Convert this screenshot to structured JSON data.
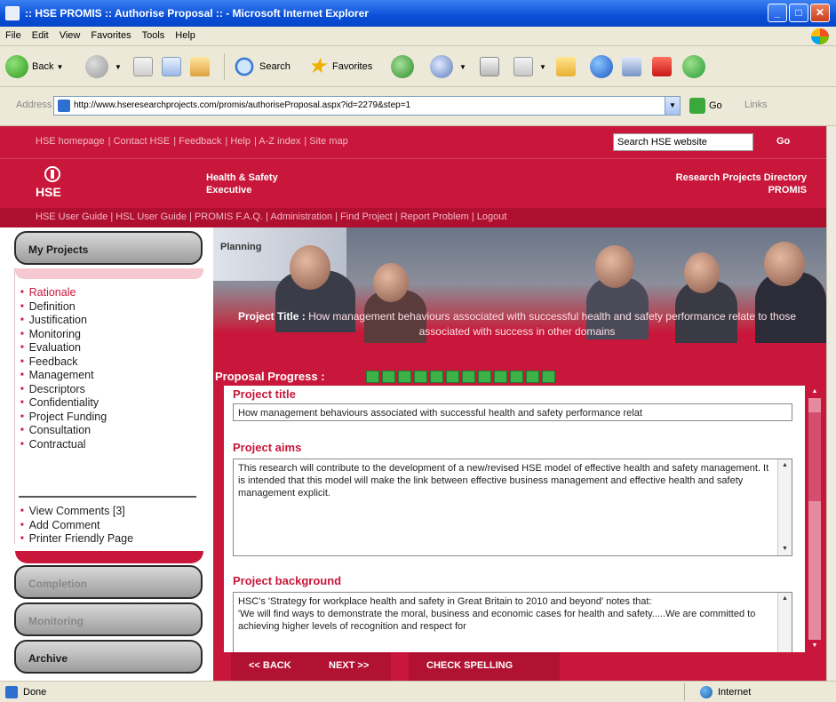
{
  "window": {
    "title": ":: HSE PROMIS :: Authorise Proposal :: - Microsoft Internet Explorer",
    "min": "_",
    "max": "□",
    "close": "✕"
  },
  "menu": [
    "File",
    "Edit",
    "View",
    "Favorites",
    "Tools",
    "Help"
  ],
  "toolbar": {
    "back": "Back",
    "search": "Search",
    "favorites": "Favorites"
  },
  "address": {
    "label": "Address",
    "url": "http://www.hseresearchprojects.com/promis/authoriseProposal.aspx?id=2279&step=1",
    "go": "Go",
    "links": "Links"
  },
  "site": {
    "top_links": [
      "HSE homepage",
      "Contact HSE",
      "Feedback",
      "Help",
      "A-Z index",
      "Site map"
    ],
    "search_value": "Search HSE website",
    "search_go": "Go",
    "logo_text": "HSE",
    "org_line1": "Health & Safety",
    "org_line2": "Executive",
    "rpd_line1": "Research Projects Directory",
    "rpd_line2": "PROMIS",
    "nav2": [
      "HSE User Guide",
      "HSL User Guide",
      "PROMIS F.A.Q.",
      "Administration",
      "Find Project",
      "Report Problem",
      "Logout"
    ]
  },
  "sidebar": {
    "my_projects": "My Projects",
    "items": [
      "Rationale",
      "Definition",
      "Justification",
      "Monitoring",
      "Evaluation",
      "Feedback",
      "Management",
      "Descriptors",
      "Confidentiality",
      "Project Funding",
      "Consultation",
      "Contractual"
    ],
    "extra": [
      "View Comments [3]",
      "Add Comment",
      "Printer Friendly Page"
    ],
    "completion": "Completion",
    "monitoring": "Monitoring",
    "archive": "Archive"
  },
  "banner": {
    "planning": "Planning",
    "title_label": "Project Title :",
    "title_text": "How management behaviours associated with successful health and safety performance relate to those associated with success in other domains"
  },
  "progress": {
    "label": "Proposal Progress :",
    "completed_steps": 12,
    "total_steps": 12
  },
  "form": {
    "title_label": "Project title",
    "title_value": "How management behaviours associated with successful health and safety performance relat",
    "aims_label": "Project aims",
    "aims_value": "This research will contribute to the development of a new/revised HSE model of effective health and safety management.  It is intended that this model will make the link between effective business management and effective health and safety management explicit.",
    "background_label": "Project background",
    "background_value": "HSC's 'Strategy for workplace health and safety in Great Britain to 2010 and beyond' notes that:\n'We will find ways to demonstrate the moral, business and economic cases for health and safety.....We are committed to achieving higher levels of recognition and respect for"
  },
  "actions": {
    "back": "<< BACK",
    "next": "NEXT >>",
    "spell": "CHECK SPELLING"
  },
  "status": {
    "done": "Done",
    "zone": "Internet"
  },
  "colors": {
    "brand": "#c8173a",
    "progress_green": "#3db24a"
  }
}
